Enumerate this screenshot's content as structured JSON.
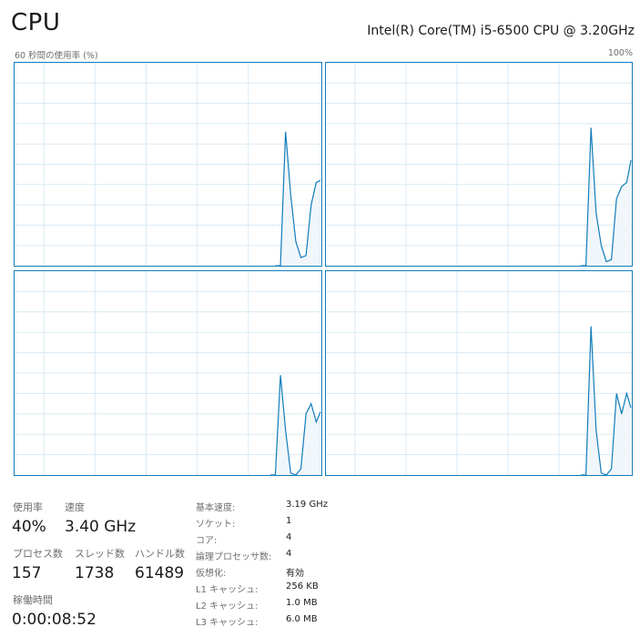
{
  "header": {
    "title": "CPU",
    "model": "Intel(R) Core(TM) i5-6500 CPU @ 3.20GHz"
  },
  "graph": {
    "axis_left_label": "60 秒間の使用率 (%)",
    "axis_right_label": "100%",
    "line_color": "#117dbb",
    "fill_color": "#f1f6fa",
    "grid_color": "#d9eaf4",
    "cores": [
      [
        0,
        0,
        0,
        0,
        0,
        0,
        0,
        0,
        0,
        0,
        0,
        0,
        0,
        0,
        0,
        0,
        0,
        0,
        0,
        0,
        0,
        0,
        0,
        0,
        0,
        0,
        0,
        0,
        0,
        0,
        0,
        0,
        0,
        0,
        0,
        0,
        0,
        0,
        0,
        0,
        0,
        0,
        0,
        0,
        0,
        0,
        0,
        0,
        0,
        0,
        0,
        0,
        0,
        66,
        35,
        12,
        4,
        5,
        30,
        41,
        42
      ],
      [
        0,
        0,
        0,
        0,
        0,
        0,
        0,
        0,
        0,
        0,
        0,
        0,
        0,
        0,
        0,
        0,
        0,
        0,
        0,
        0,
        0,
        0,
        0,
        0,
        0,
        0,
        0,
        0,
        0,
        0,
        0,
        0,
        0,
        0,
        0,
        0,
        0,
        0,
        0,
        0,
        0,
        0,
        0,
        0,
        0,
        0,
        0,
        0,
        0,
        0,
        0,
        0,
        0,
        68,
        26,
        10,
        2,
        3,
        33,
        39,
        41,
        52
      ],
      [
        0,
        0,
        0,
        0,
        0,
        0,
        0,
        0,
        0,
        0,
        0,
        0,
        0,
        0,
        0,
        0,
        0,
        0,
        0,
        0,
        0,
        0,
        0,
        0,
        0,
        0,
        0,
        0,
        0,
        0,
        0,
        0,
        0,
        0,
        0,
        0,
        0,
        0,
        0,
        0,
        0,
        0,
        0,
        0,
        0,
        0,
        0,
        0,
        0,
        0,
        0,
        0,
        0,
        49,
        22,
        1,
        0,
        3,
        30,
        35,
        26,
        31
      ],
      [
        0,
        0,
        0,
        0,
        0,
        0,
        0,
        0,
        0,
        0,
        0,
        0,
        0,
        0,
        0,
        0,
        0,
        0,
        0,
        0,
        0,
        0,
        0,
        0,
        0,
        0,
        0,
        0,
        0,
        0,
        0,
        0,
        0,
        0,
        0,
        0,
        0,
        0,
        0,
        0,
        0,
        0,
        0,
        0,
        0,
        0,
        0,
        0,
        0,
        0,
        0,
        0,
        0,
        73,
        22,
        1,
        0,
        3,
        40,
        30,
        40,
        33
      ]
    ]
  },
  "stats": {
    "utilization_label": "使用率",
    "utilization_value": "40%",
    "speed_label": "速度",
    "speed_value": "3.40 GHz",
    "processes_label": "プロセス数",
    "processes_value": "157",
    "threads_label": "スレッド数",
    "threads_value": "1738",
    "handles_label": "ハンドル数",
    "handles_value": "61489",
    "uptime_label": "稼働時間",
    "uptime_value": "0:00:08:52"
  },
  "specs": [
    {
      "label": "基本速度:",
      "value": "3.19 GHz"
    },
    {
      "label": "ソケット:",
      "value": "1"
    },
    {
      "label": "コア:",
      "value": "4"
    },
    {
      "label": "論理プロセッサ数:",
      "value": "4"
    },
    {
      "label": "仮想化:",
      "value": "有効"
    },
    {
      "label": "L1 キャッシュ:",
      "value": "256 KB"
    },
    {
      "label": "L2 キャッシュ:",
      "value": "1.0 MB"
    },
    {
      "label": "L3 キャッシュ:",
      "value": "6.0 MB"
    }
  ]
}
